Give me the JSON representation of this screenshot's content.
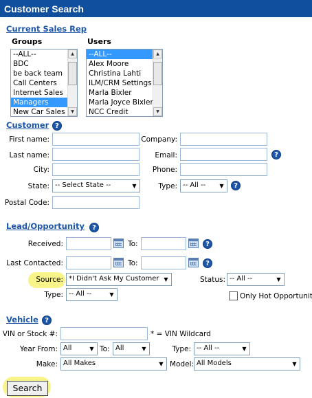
{
  "title": "Customer Search",
  "sales_rep": {
    "section_label": "Current Sales Rep",
    "groups_label": "Groups",
    "users_label": "Users",
    "groups": [
      "--ALL--",
      "BDC",
      "be back team",
      "Call Centers",
      "Internet Sales",
      "Managers",
      "New Car Sales"
    ],
    "groups_selected": "Managers",
    "users": [
      "--ALL--",
      "Alex Moore",
      "Christina Lahti",
      "ILM/CRM Settings",
      "Marla Bixler",
      "Marla Joyce Bixler",
      "NCC Credit"
    ],
    "users_selected": "--ALL--"
  },
  "customer": {
    "section_label": "Customer",
    "first_name_label": "First name:",
    "last_name_label": "Last name:",
    "city_label": "City:",
    "state_label": "State:",
    "state_value": "-- Select State --",
    "postal_label": "Postal Code:",
    "company_label": "Company:",
    "email_label": "Email:",
    "phone_label": "Phone:",
    "type_label": "Type:",
    "type_value": "-- All --"
  },
  "lead": {
    "section_label": "Lead/Opportunity",
    "received_label": "Received:",
    "to_label": "To:",
    "last_contacted_label": "Last Contacted:",
    "source_label": "Source:",
    "source_value": "*I Didn't Ask My Customer",
    "status_label": "Status:",
    "status_value": "-- All --",
    "type_label": "Type:",
    "type_value": "-- All --",
    "hot_label": "Only Hot Opportunities"
  },
  "vehicle": {
    "section_label": "Vehicle",
    "vin_label": "VIN or Stock #:",
    "vin_hint": "* = VIN Wildcard",
    "year_from_label": "Year From:",
    "year_from_value": "All",
    "year_to_label": "To:",
    "year_to_value": "All",
    "type_label": "Type:",
    "type_value": "-- All --",
    "make_label": "Make:",
    "make_value": "All Makes",
    "model_label": "Model:",
    "model_value": "All Models"
  },
  "search_button": "Search",
  "colors": {
    "title_bg": "#0f4f9b",
    "section": "#1d56a8",
    "highlight": "#f8f48a",
    "selection": "#3399ff"
  }
}
